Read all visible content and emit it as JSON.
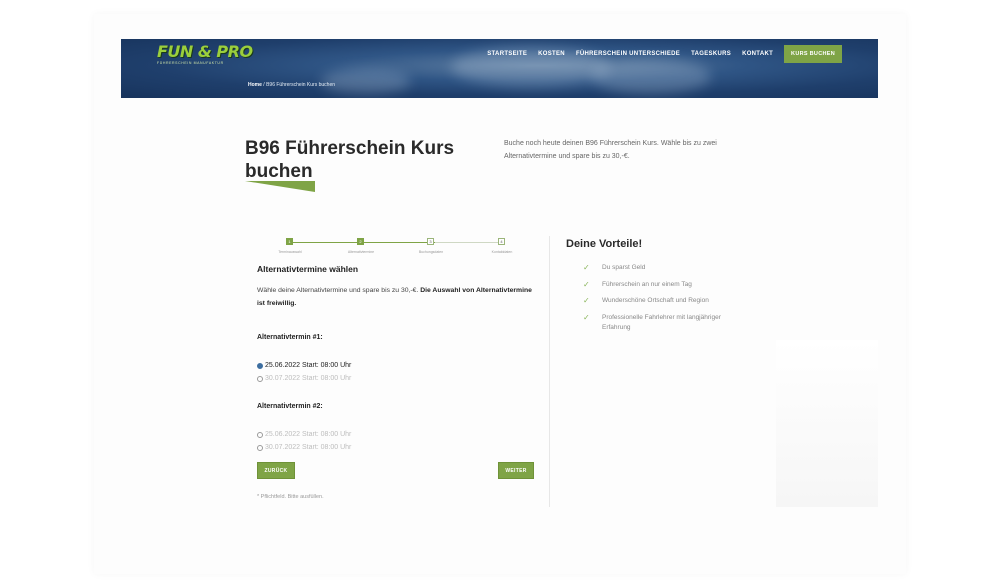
{
  "brand": {
    "logo_main": "FUN & PRO",
    "logo_sub": "FÜHRERSCHEIN MANUFAKTUR"
  },
  "nav": {
    "items": [
      "STARTSEITE",
      "KOSTEN",
      "FÜHRERSCHEIN UNTERSCHIEDE",
      "TAGESKURS",
      "KONTAKT"
    ],
    "cta": "KURS BUCHEN"
  },
  "breadcrumb": {
    "home": "Home",
    "separator": " / ",
    "current": "B96 Führerschein Kurs buchen"
  },
  "heading": {
    "title": "B96 Führerschein Kurs buchen",
    "intro": "Buche noch heute deinen B96 Führerschein Kurs. Wähle bis zu zwei Alternativtermine und spare bis zu 30,-€."
  },
  "steps": [
    {
      "number": "1",
      "label": "Terminauswahl",
      "done": true
    },
    {
      "number": "2",
      "label": "Alternativtermine",
      "done": true
    },
    {
      "number": "3",
      "label": "Buchungsdaten",
      "done": false
    },
    {
      "number": "4",
      "label": "Kontaktdaten",
      "done": false
    }
  ],
  "form": {
    "title": "Alternativtermine wählen",
    "desc_prefix": "Wähle deine Alternativtermine und spare bis zu 30,-€. ",
    "desc_bold": "Die Auswahl von Alternativtermine ist freiwillig.",
    "alt1": {
      "label": "Alternativtermin #1:",
      "options": [
        {
          "text": "25.06.2022 Start: 08:00 Uhr",
          "selected": true
        },
        {
          "text": "30.07.2022 Start: 08:00 Uhr",
          "selected": false
        }
      ]
    },
    "alt2": {
      "label": "Alternativtermin #2:",
      "options": [
        {
          "text": "25.06.2022 Start: 08:00 Uhr",
          "selected": false
        },
        {
          "text": "30.07.2022 Start: 08:00 Uhr",
          "selected": false
        }
      ]
    },
    "back_label": "ZURÜCK",
    "next_label": "WEITER",
    "required_note": "* Pflichtfeld. Bitte ausfüllen."
  },
  "sidebar": {
    "title": "Deine Vorteile!",
    "benefits": [
      "Du sparst Geld",
      "Führerschein an nur einem Tag",
      "Wunderschöne Ortschaft und Region",
      "Professionelle Fahrlehrer mit langjähriger Erfahrung"
    ]
  },
  "colors": {
    "accent": "#7fa446",
    "hero": "#1f3f6c",
    "radio_selected": "#3d6ea0"
  }
}
